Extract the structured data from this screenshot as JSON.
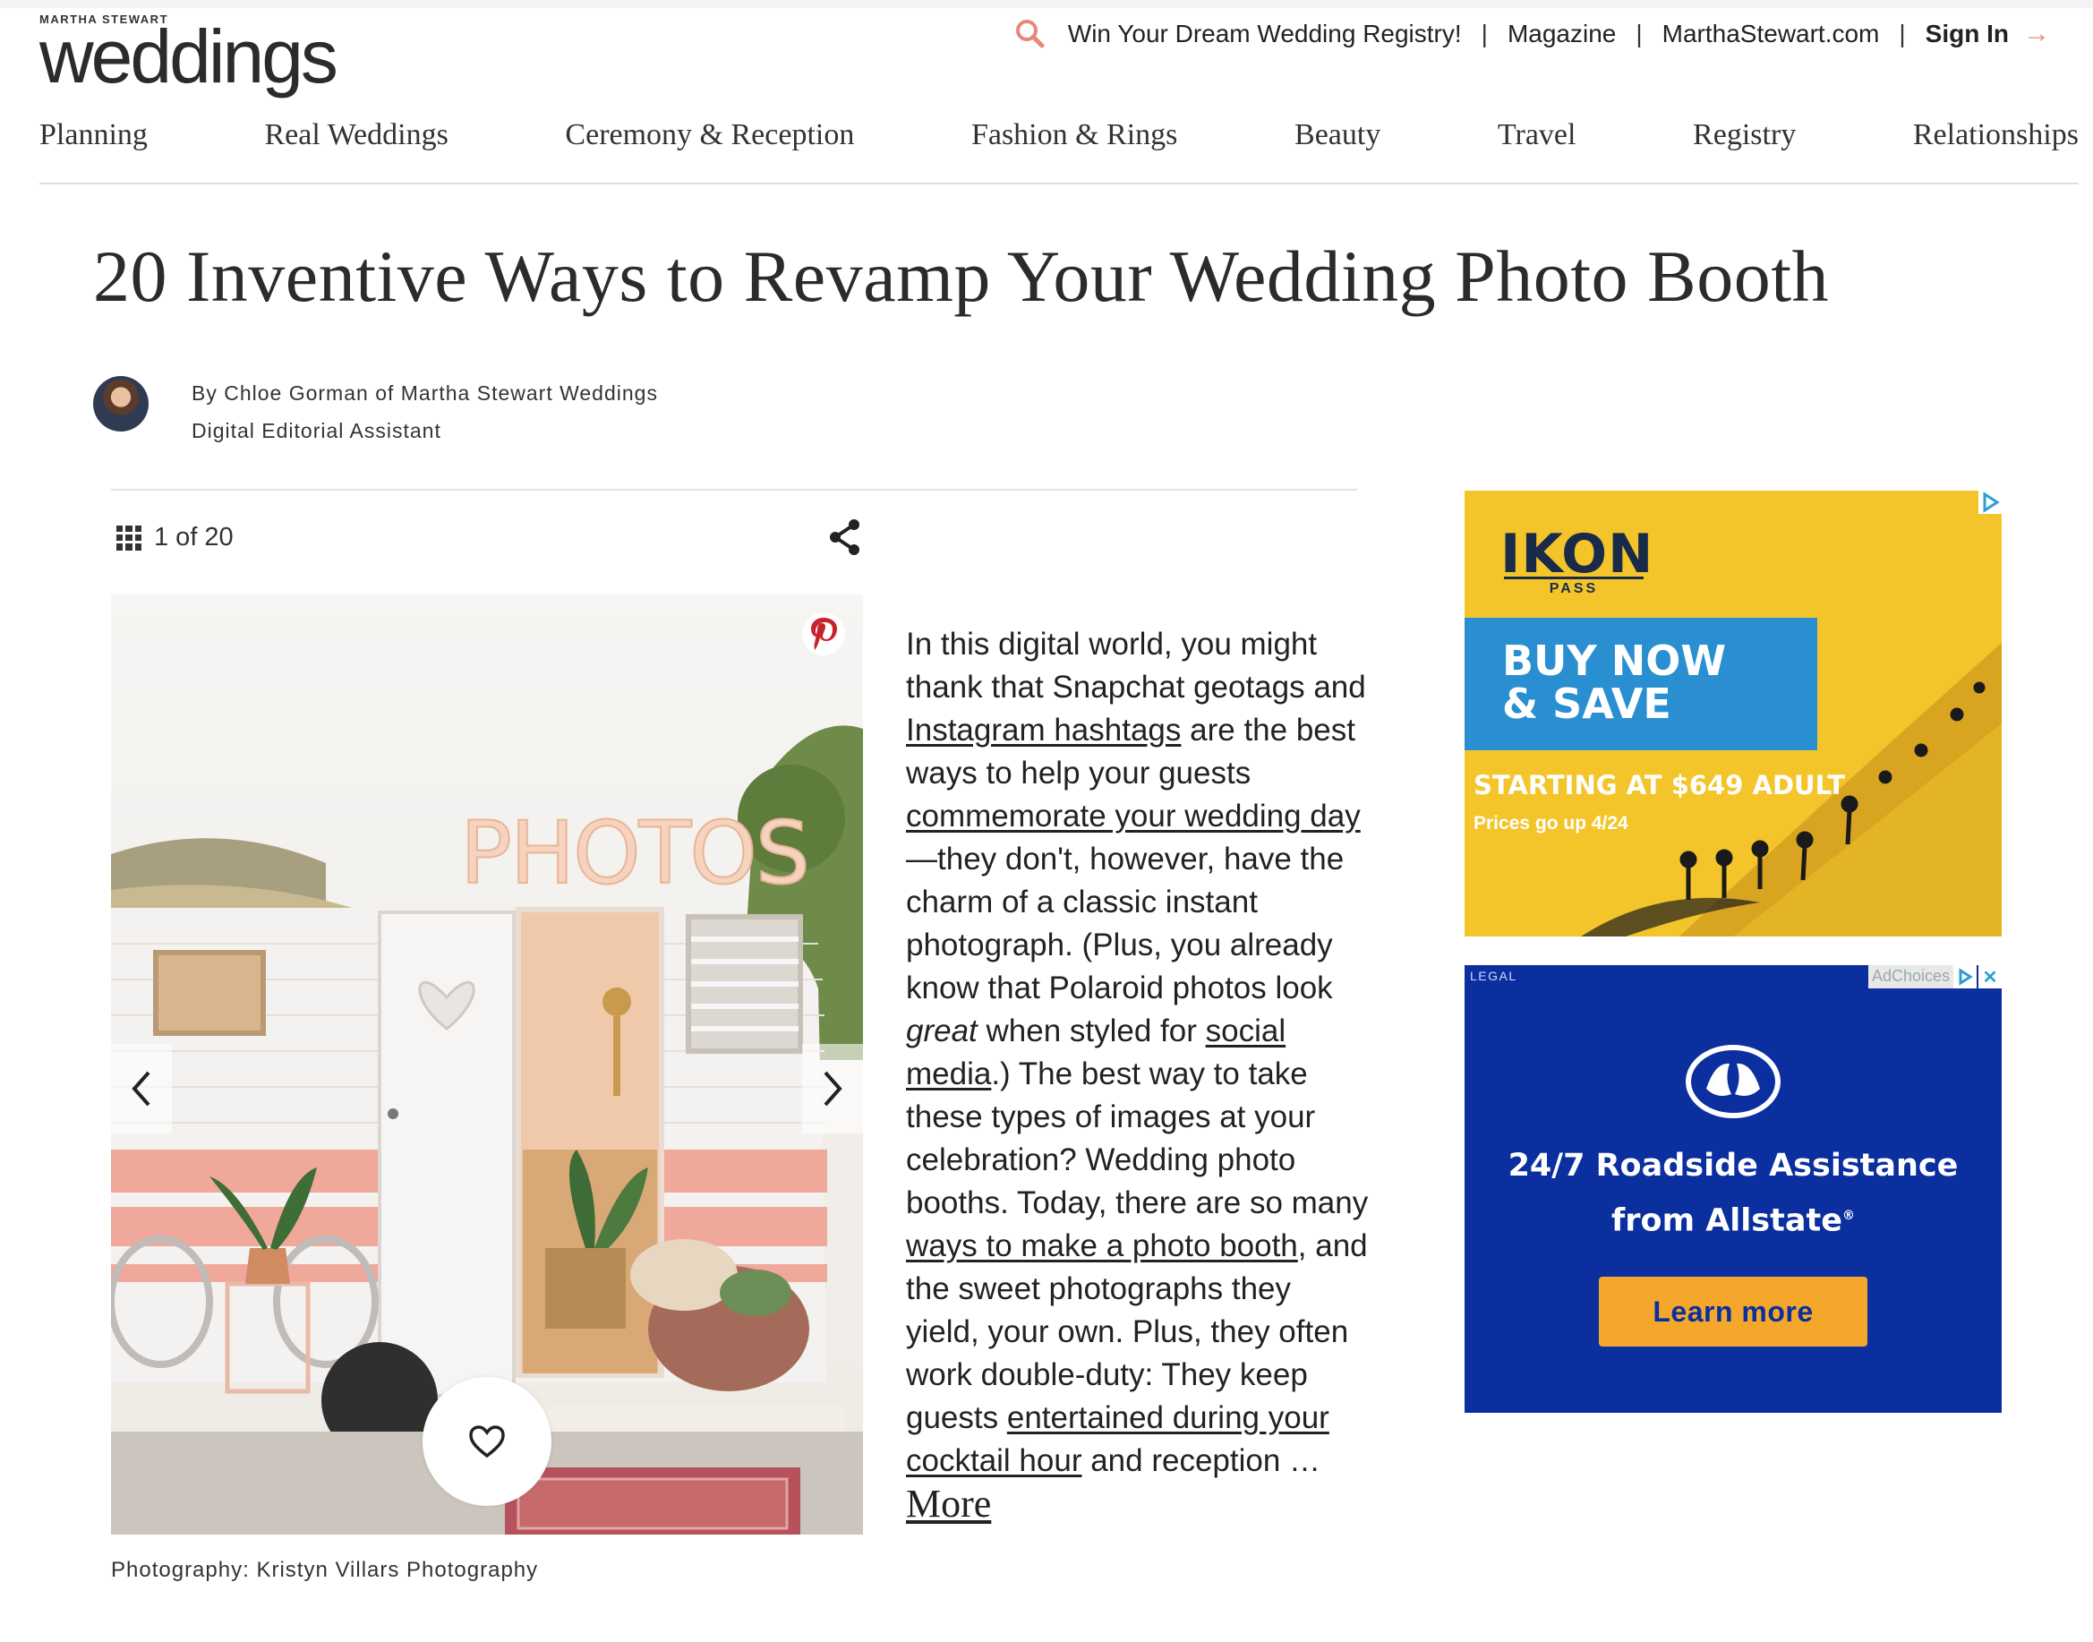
{
  "header": {
    "logo_small": "MARTHA STEWART",
    "logo_big": "weddings",
    "util_links": [
      "Win Your Dream Wedding Registry!",
      "Magazine",
      "MarthaStewart.com"
    ],
    "sign_in": "Sign In",
    "separator": "|",
    "arrow": "→"
  },
  "nav": {
    "items": [
      "Planning",
      "Real Weddings",
      "Ceremony & Reception",
      "Fashion & Rings",
      "Beauty",
      "Travel",
      "Registry",
      "Relationships"
    ]
  },
  "article": {
    "title": "20 Inventive Ways to Revamp Your Wedding Photo Booth",
    "author": "By Chloe Gorman of Martha Stewart Weddings",
    "author_role": "Digital Editorial Assistant",
    "counter": "1 of 20",
    "photo_caption": "Photography: Kristyn Villars Photography",
    "photo_sign": "PHOTOS",
    "body": {
      "t1": "In this digital world, you might thank that Snapchat geotags and ",
      "l1": "Instagram hashtags",
      "t2": " are the best ways to help your guests ",
      "l2": "commemorate your wedding day",
      "t3": "—they don't, however, have the charm of a classic instant photograph. (Plus, you already know that Polaroid photos look ",
      "em": "great",
      "t4": " when styled for ",
      "l3": "social media",
      "t5": ".) The best way to take these types of images at your celebration? Wedding photo booths. Today, there are so many ",
      "l4": "ways to make a photo booth",
      "t6": ", and the sweet photographs they yield, your own. Plus, they often work double-duty: They keep guests ",
      "l5": "entertained during your cocktail hour",
      "t7": " and reception … ",
      "more": "More"
    }
  },
  "ads": {
    "ikon": {
      "brand": "IKON",
      "brand_sub": "PASS",
      "headline_1": "BUY NOW",
      "headline_2": "& SAVE",
      "offer": "STARTING AT $649 ADULT",
      "note": "Prices go up 4/24"
    },
    "allstate": {
      "legal": "LEGAL",
      "adchoices": "AdChoices",
      "line1": "24/7 Roadside Assistance",
      "line2": "from Allstate",
      "reg": "®",
      "cta": "Learn more",
      "close": "✕"
    }
  },
  "colors": {
    "accent": "#e9877a",
    "pinterest": "#c8232c",
    "ikon_yellow": "#f3c52a",
    "ikon_blue": "#2a8fd0",
    "allstate_blue": "#0b2f9e",
    "allstate_orange": "#f4a72a"
  }
}
